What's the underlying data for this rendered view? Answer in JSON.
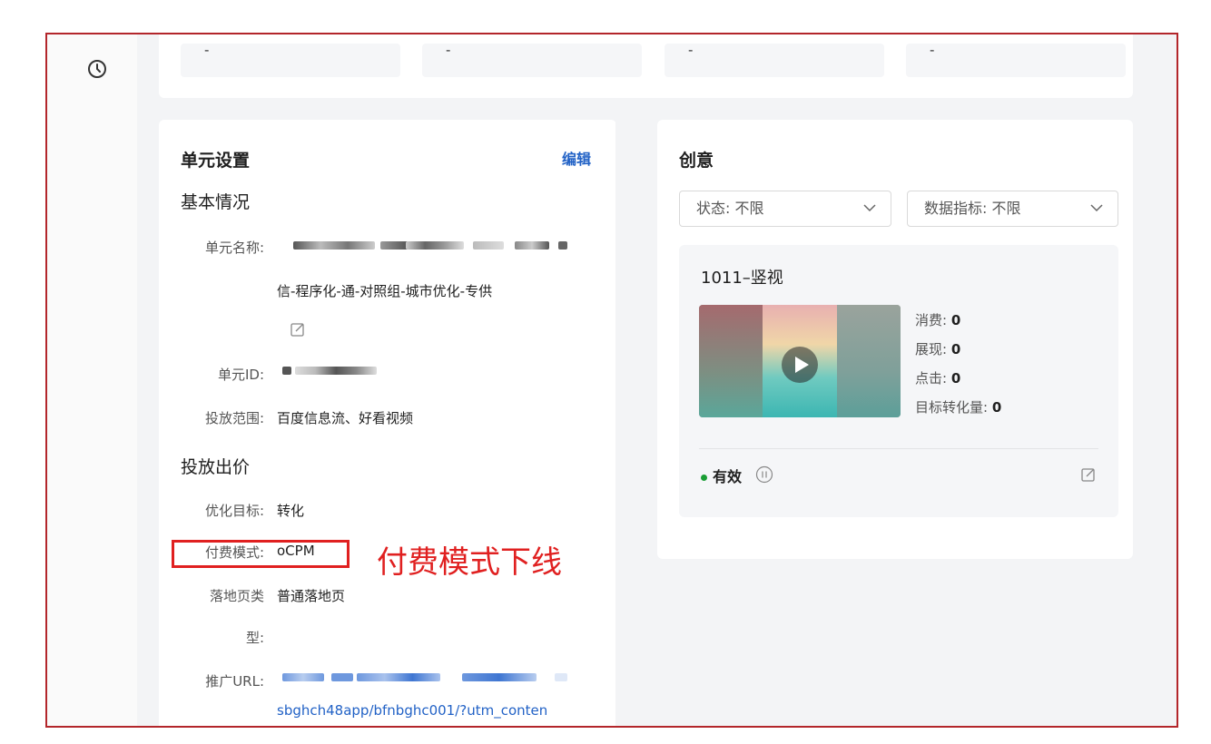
{
  "metrics": {
    "placeholders": [
      "-",
      "-",
      "-",
      "-"
    ]
  },
  "unit": {
    "title": "单元设置",
    "edit_label": "编辑",
    "basic_heading": "基本情况",
    "name_label": "单元名称:",
    "name_value_line2": "信-程序化-通-对照组-城市优化-专供",
    "id_label": "单元ID:",
    "scope_label": "投放范围:",
    "scope_value": "百度信息流、好看视频",
    "bid_heading": "投放出价",
    "target_label": "优化目标:",
    "target_value": "转化",
    "pay_label": "付费模式:",
    "pay_value": "oCPM",
    "landing_label_line1": "落地页类",
    "landing_label_line2": "型:",
    "landing_value": "普通落地页",
    "url_label": "推广URL:",
    "url_value_line2": "sbghch48app/bfnbghc001/?utm_conten"
  },
  "creative": {
    "title": "创意",
    "status_filter": "状态: 不限",
    "metric_filter": "数据指标: 不限",
    "item_name": "1011–竖视",
    "stats": [
      {
        "label": "消费:",
        "value": "0"
      },
      {
        "label": "展现:",
        "value": "0"
      },
      {
        "label": "点击:",
        "value": "0"
      },
      {
        "label": "目标转化量:",
        "value": "0"
      }
    ],
    "status_text": "有效",
    "status_color": "#1a9e35"
  },
  "annotation": {
    "text": "付费模式下线",
    "color": "#e02020"
  }
}
